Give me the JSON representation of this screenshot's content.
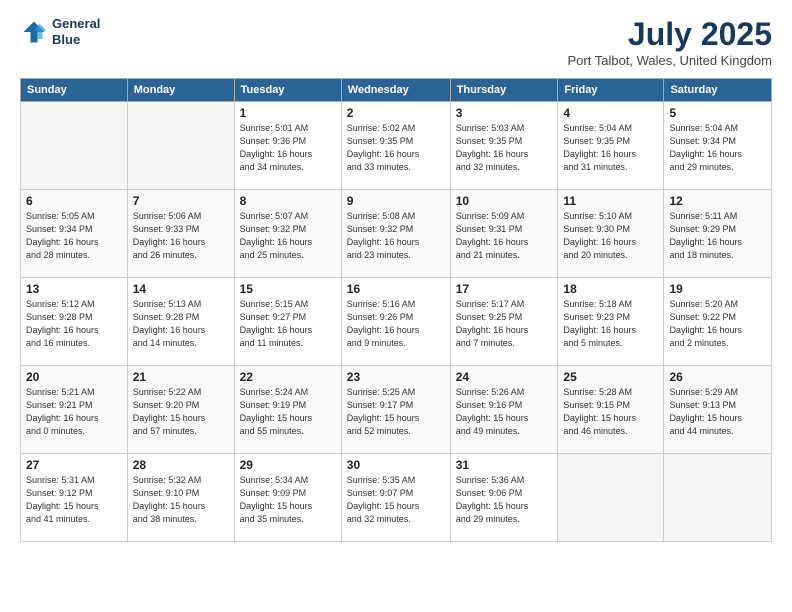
{
  "logo": {
    "line1": "General",
    "line2": "Blue"
  },
  "title": "July 2025",
  "location": "Port Talbot, Wales, United Kingdom",
  "weekdays": [
    "Sunday",
    "Monday",
    "Tuesday",
    "Wednesday",
    "Thursday",
    "Friday",
    "Saturday"
  ],
  "weeks": [
    [
      {
        "day": "",
        "info": ""
      },
      {
        "day": "",
        "info": ""
      },
      {
        "day": "1",
        "info": "Sunrise: 5:01 AM\nSunset: 9:36 PM\nDaylight: 16 hours\nand 34 minutes."
      },
      {
        "day": "2",
        "info": "Sunrise: 5:02 AM\nSunset: 9:35 PM\nDaylight: 16 hours\nand 33 minutes."
      },
      {
        "day": "3",
        "info": "Sunrise: 5:03 AM\nSunset: 9:35 PM\nDaylight: 16 hours\nand 32 minutes."
      },
      {
        "day": "4",
        "info": "Sunrise: 5:04 AM\nSunset: 9:35 PM\nDaylight: 16 hours\nand 31 minutes."
      },
      {
        "day": "5",
        "info": "Sunrise: 5:04 AM\nSunset: 9:34 PM\nDaylight: 16 hours\nand 29 minutes."
      }
    ],
    [
      {
        "day": "6",
        "info": "Sunrise: 5:05 AM\nSunset: 9:34 PM\nDaylight: 16 hours\nand 28 minutes."
      },
      {
        "day": "7",
        "info": "Sunrise: 5:06 AM\nSunset: 9:33 PM\nDaylight: 16 hours\nand 26 minutes."
      },
      {
        "day": "8",
        "info": "Sunrise: 5:07 AM\nSunset: 9:32 PM\nDaylight: 16 hours\nand 25 minutes."
      },
      {
        "day": "9",
        "info": "Sunrise: 5:08 AM\nSunset: 9:32 PM\nDaylight: 16 hours\nand 23 minutes."
      },
      {
        "day": "10",
        "info": "Sunrise: 5:09 AM\nSunset: 9:31 PM\nDaylight: 16 hours\nand 21 minutes."
      },
      {
        "day": "11",
        "info": "Sunrise: 5:10 AM\nSunset: 9:30 PM\nDaylight: 16 hours\nand 20 minutes."
      },
      {
        "day": "12",
        "info": "Sunrise: 5:11 AM\nSunset: 9:29 PM\nDaylight: 16 hours\nand 18 minutes."
      }
    ],
    [
      {
        "day": "13",
        "info": "Sunrise: 5:12 AM\nSunset: 9:28 PM\nDaylight: 16 hours\nand 16 minutes."
      },
      {
        "day": "14",
        "info": "Sunrise: 5:13 AM\nSunset: 9:28 PM\nDaylight: 16 hours\nand 14 minutes."
      },
      {
        "day": "15",
        "info": "Sunrise: 5:15 AM\nSunset: 9:27 PM\nDaylight: 16 hours\nand 11 minutes."
      },
      {
        "day": "16",
        "info": "Sunrise: 5:16 AM\nSunset: 9:26 PM\nDaylight: 16 hours\nand 9 minutes."
      },
      {
        "day": "17",
        "info": "Sunrise: 5:17 AM\nSunset: 9:25 PM\nDaylight: 16 hours\nand 7 minutes."
      },
      {
        "day": "18",
        "info": "Sunrise: 5:18 AM\nSunset: 9:23 PM\nDaylight: 16 hours\nand 5 minutes."
      },
      {
        "day": "19",
        "info": "Sunrise: 5:20 AM\nSunset: 9:22 PM\nDaylight: 16 hours\nand 2 minutes."
      }
    ],
    [
      {
        "day": "20",
        "info": "Sunrise: 5:21 AM\nSunset: 9:21 PM\nDaylight: 16 hours\nand 0 minutes."
      },
      {
        "day": "21",
        "info": "Sunrise: 5:22 AM\nSunset: 9:20 PM\nDaylight: 15 hours\nand 57 minutes."
      },
      {
        "day": "22",
        "info": "Sunrise: 5:24 AM\nSunset: 9:19 PM\nDaylight: 15 hours\nand 55 minutes."
      },
      {
        "day": "23",
        "info": "Sunrise: 5:25 AM\nSunset: 9:17 PM\nDaylight: 15 hours\nand 52 minutes."
      },
      {
        "day": "24",
        "info": "Sunrise: 5:26 AM\nSunset: 9:16 PM\nDaylight: 15 hours\nand 49 minutes."
      },
      {
        "day": "25",
        "info": "Sunrise: 5:28 AM\nSunset: 9:15 PM\nDaylight: 15 hours\nand 46 minutes."
      },
      {
        "day": "26",
        "info": "Sunrise: 5:29 AM\nSunset: 9:13 PM\nDaylight: 15 hours\nand 44 minutes."
      }
    ],
    [
      {
        "day": "27",
        "info": "Sunrise: 5:31 AM\nSunset: 9:12 PM\nDaylight: 15 hours\nand 41 minutes."
      },
      {
        "day": "28",
        "info": "Sunrise: 5:32 AM\nSunset: 9:10 PM\nDaylight: 15 hours\nand 38 minutes."
      },
      {
        "day": "29",
        "info": "Sunrise: 5:34 AM\nSunset: 9:09 PM\nDaylight: 15 hours\nand 35 minutes."
      },
      {
        "day": "30",
        "info": "Sunrise: 5:35 AM\nSunset: 9:07 PM\nDaylight: 15 hours\nand 32 minutes."
      },
      {
        "day": "31",
        "info": "Sunrise: 5:36 AM\nSunset: 9:06 PM\nDaylight: 15 hours\nand 29 minutes."
      },
      {
        "day": "",
        "info": ""
      },
      {
        "day": "",
        "info": ""
      }
    ]
  ]
}
